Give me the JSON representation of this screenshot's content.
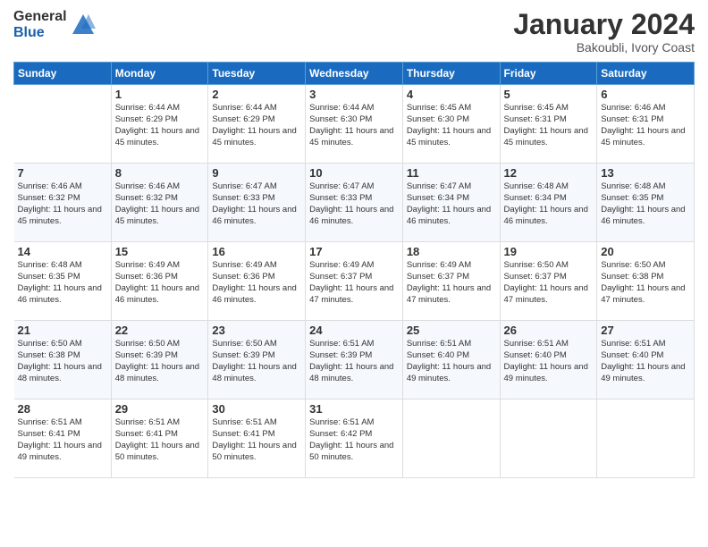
{
  "logo": {
    "general": "General",
    "blue": "Blue"
  },
  "header": {
    "title": "January 2024",
    "location": "Bakoubli, Ivory Coast"
  },
  "weekdays": [
    "Sunday",
    "Monday",
    "Tuesday",
    "Wednesday",
    "Thursday",
    "Friday",
    "Saturday"
  ],
  "weeks": [
    [
      {
        "day": "",
        "sunrise": "",
        "sunset": "",
        "daylight": ""
      },
      {
        "day": "1",
        "sunrise": "Sunrise: 6:44 AM",
        "sunset": "Sunset: 6:29 PM",
        "daylight": "Daylight: 11 hours and 45 minutes."
      },
      {
        "day": "2",
        "sunrise": "Sunrise: 6:44 AM",
        "sunset": "Sunset: 6:29 PM",
        "daylight": "Daylight: 11 hours and 45 minutes."
      },
      {
        "day": "3",
        "sunrise": "Sunrise: 6:44 AM",
        "sunset": "Sunset: 6:30 PM",
        "daylight": "Daylight: 11 hours and 45 minutes."
      },
      {
        "day": "4",
        "sunrise": "Sunrise: 6:45 AM",
        "sunset": "Sunset: 6:30 PM",
        "daylight": "Daylight: 11 hours and 45 minutes."
      },
      {
        "day": "5",
        "sunrise": "Sunrise: 6:45 AM",
        "sunset": "Sunset: 6:31 PM",
        "daylight": "Daylight: 11 hours and 45 minutes."
      },
      {
        "day": "6",
        "sunrise": "Sunrise: 6:46 AM",
        "sunset": "Sunset: 6:31 PM",
        "daylight": "Daylight: 11 hours and 45 minutes."
      }
    ],
    [
      {
        "day": "7",
        "sunrise": "Sunrise: 6:46 AM",
        "sunset": "Sunset: 6:32 PM",
        "daylight": "Daylight: 11 hours and 45 minutes."
      },
      {
        "day": "8",
        "sunrise": "Sunrise: 6:46 AM",
        "sunset": "Sunset: 6:32 PM",
        "daylight": "Daylight: 11 hours and 45 minutes."
      },
      {
        "day": "9",
        "sunrise": "Sunrise: 6:47 AM",
        "sunset": "Sunset: 6:33 PM",
        "daylight": "Daylight: 11 hours and 46 minutes."
      },
      {
        "day": "10",
        "sunrise": "Sunrise: 6:47 AM",
        "sunset": "Sunset: 6:33 PM",
        "daylight": "Daylight: 11 hours and 46 minutes."
      },
      {
        "day": "11",
        "sunrise": "Sunrise: 6:47 AM",
        "sunset": "Sunset: 6:34 PM",
        "daylight": "Daylight: 11 hours and 46 minutes."
      },
      {
        "day": "12",
        "sunrise": "Sunrise: 6:48 AM",
        "sunset": "Sunset: 6:34 PM",
        "daylight": "Daylight: 11 hours and 46 minutes."
      },
      {
        "day": "13",
        "sunrise": "Sunrise: 6:48 AM",
        "sunset": "Sunset: 6:35 PM",
        "daylight": "Daylight: 11 hours and 46 minutes."
      }
    ],
    [
      {
        "day": "14",
        "sunrise": "Sunrise: 6:48 AM",
        "sunset": "Sunset: 6:35 PM",
        "daylight": "Daylight: 11 hours and 46 minutes."
      },
      {
        "day": "15",
        "sunrise": "Sunrise: 6:49 AM",
        "sunset": "Sunset: 6:36 PM",
        "daylight": "Daylight: 11 hours and 46 minutes."
      },
      {
        "day": "16",
        "sunrise": "Sunrise: 6:49 AM",
        "sunset": "Sunset: 6:36 PM",
        "daylight": "Daylight: 11 hours and 46 minutes."
      },
      {
        "day": "17",
        "sunrise": "Sunrise: 6:49 AM",
        "sunset": "Sunset: 6:37 PM",
        "daylight": "Daylight: 11 hours and 47 minutes."
      },
      {
        "day": "18",
        "sunrise": "Sunrise: 6:49 AM",
        "sunset": "Sunset: 6:37 PM",
        "daylight": "Daylight: 11 hours and 47 minutes."
      },
      {
        "day": "19",
        "sunrise": "Sunrise: 6:50 AM",
        "sunset": "Sunset: 6:37 PM",
        "daylight": "Daylight: 11 hours and 47 minutes."
      },
      {
        "day": "20",
        "sunrise": "Sunrise: 6:50 AM",
        "sunset": "Sunset: 6:38 PM",
        "daylight": "Daylight: 11 hours and 47 minutes."
      }
    ],
    [
      {
        "day": "21",
        "sunrise": "Sunrise: 6:50 AM",
        "sunset": "Sunset: 6:38 PM",
        "daylight": "Daylight: 11 hours and 48 minutes."
      },
      {
        "day": "22",
        "sunrise": "Sunrise: 6:50 AM",
        "sunset": "Sunset: 6:39 PM",
        "daylight": "Daylight: 11 hours and 48 minutes."
      },
      {
        "day": "23",
        "sunrise": "Sunrise: 6:50 AM",
        "sunset": "Sunset: 6:39 PM",
        "daylight": "Daylight: 11 hours and 48 minutes."
      },
      {
        "day": "24",
        "sunrise": "Sunrise: 6:51 AM",
        "sunset": "Sunset: 6:39 PM",
        "daylight": "Daylight: 11 hours and 48 minutes."
      },
      {
        "day": "25",
        "sunrise": "Sunrise: 6:51 AM",
        "sunset": "Sunset: 6:40 PM",
        "daylight": "Daylight: 11 hours and 49 minutes."
      },
      {
        "day": "26",
        "sunrise": "Sunrise: 6:51 AM",
        "sunset": "Sunset: 6:40 PM",
        "daylight": "Daylight: 11 hours and 49 minutes."
      },
      {
        "day": "27",
        "sunrise": "Sunrise: 6:51 AM",
        "sunset": "Sunset: 6:40 PM",
        "daylight": "Daylight: 11 hours and 49 minutes."
      }
    ],
    [
      {
        "day": "28",
        "sunrise": "Sunrise: 6:51 AM",
        "sunset": "Sunset: 6:41 PM",
        "daylight": "Daylight: 11 hours and 49 minutes."
      },
      {
        "day": "29",
        "sunrise": "Sunrise: 6:51 AM",
        "sunset": "Sunset: 6:41 PM",
        "daylight": "Daylight: 11 hours and 50 minutes."
      },
      {
        "day": "30",
        "sunrise": "Sunrise: 6:51 AM",
        "sunset": "Sunset: 6:41 PM",
        "daylight": "Daylight: 11 hours and 50 minutes."
      },
      {
        "day": "31",
        "sunrise": "Sunrise: 6:51 AM",
        "sunset": "Sunset: 6:42 PM",
        "daylight": "Daylight: 11 hours and 50 minutes."
      },
      {
        "day": "",
        "sunrise": "",
        "sunset": "",
        "daylight": ""
      },
      {
        "day": "",
        "sunrise": "",
        "sunset": "",
        "daylight": ""
      },
      {
        "day": "",
        "sunrise": "",
        "sunset": "",
        "daylight": ""
      }
    ]
  ]
}
